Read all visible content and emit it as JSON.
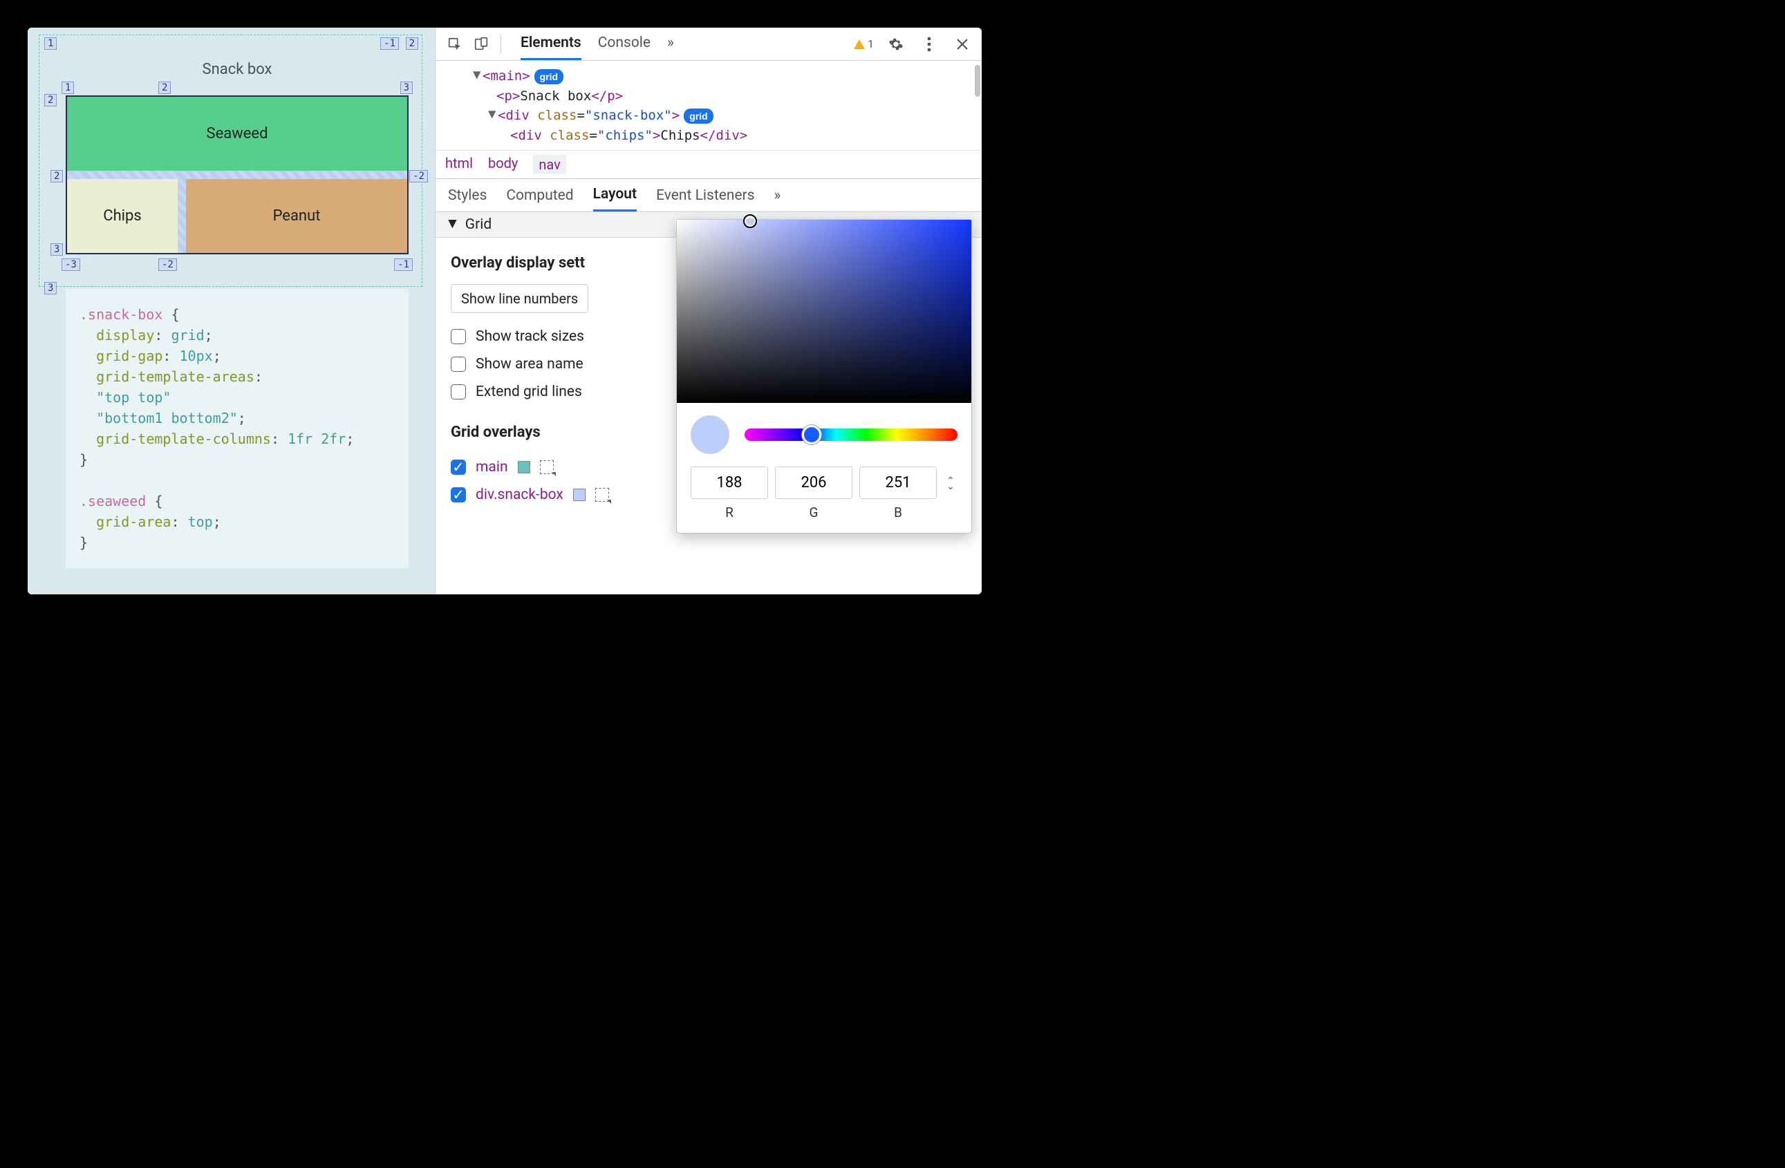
{
  "preview": {
    "title": "Snack box",
    "cells": {
      "seaweed": "Seaweed",
      "chips": "Chips",
      "peanut": "Peanut"
    },
    "outer_markers": {
      "tl": "1",
      "tr": "-1",
      "tr2": "2",
      "row2l": "2",
      "bl": "3"
    },
    "inner_markers": {
      "top": [
        "1",
        "2",
        "3"
      ],
      "mid_left": "2",
      "mid_right": "-2",
      "bot_left": "3",
      "bot_mid": "-2",
      "bot_right": "-1",
      "bot_left2": "-3"
    }
  },
  "css": {
    "rule1_sel": ".snack-box",
    "rule1_decls": [
      [
        "display",
        "grid"
      ],
      [
        "grid-gap",
        "10px"
      ],
      [
        "grid-template-areas",
        ""
      ],
      [
        "",
        "\"top top\""
      ],
      [
        "",
        "\"bottom1 bottom2\""
      ],
      [
        "grid-template-columns",
        "1fr 2fr"
      ]
    ],
    "rule2_sel": ".seaweed",
    "rule2_decl": [
      "grid-area",
      "top"
    ]
  },
  "devtools": {
    "main_tabs": [
      "Elements",
      "Console"
    ],
    "more": "»",
    "warn_count": "1",
    "dom": {
      "l1_open": "<",
      "l1_tag": "main",
      "l1_close": ">",
      "grid_badge": "grid",
      "p_open": "<",
      "p_tag": "p",
      "p_close": ">",
      "p_text": "Snack box",
      "p_end": "</",
      "p_end2": ">",
      "div_open": "<",
      "div_tag": "div",
      "div_attr": "class",
      "div_val": "\"snack-box\"",
      "div_close": ">",
      "chips_open": "<",
      "chips_tag": "div",
      "chips_attr": "class",
      "chips_val": "\"chips\"",
      "chips_close": ">",
      "chips_text": "Chips",
      "chips_end": "</",
      "chips_end2": ">"
    },
    "breadcrumb": [
      "html",
      "body",
      "nav"
    ],
    "sub_tabs": [
      "Styles",
      "Computed",
      "Layout",
      "Event Listeners"
    ],
    "grid_section": "Grid",
    "overlay_heading": "Overlay display sett",
    "dropdown": "Show line numbers",
    "checks": [
      "Show track sizes",
      "Show area name",
      "Extend grid lines"
    ],
    "overlays_heading": "Grid overlays",
    "overlays": [
      {
        "label": "main",
        "swatch": "#6cc0bc",
        "checked": true
      },
      {
        "label": "div.snack-box",
        "swatch": "#bccefb",
        "checked": true
      }
    ]
  },
  "picker": {
    "rgb": [
      "188",
      "206",
      "251"
    ],
    "labels": [
      "R",
      "G",
      "B"
    ],
    "preview_color": "#bccefb"
  }
}
